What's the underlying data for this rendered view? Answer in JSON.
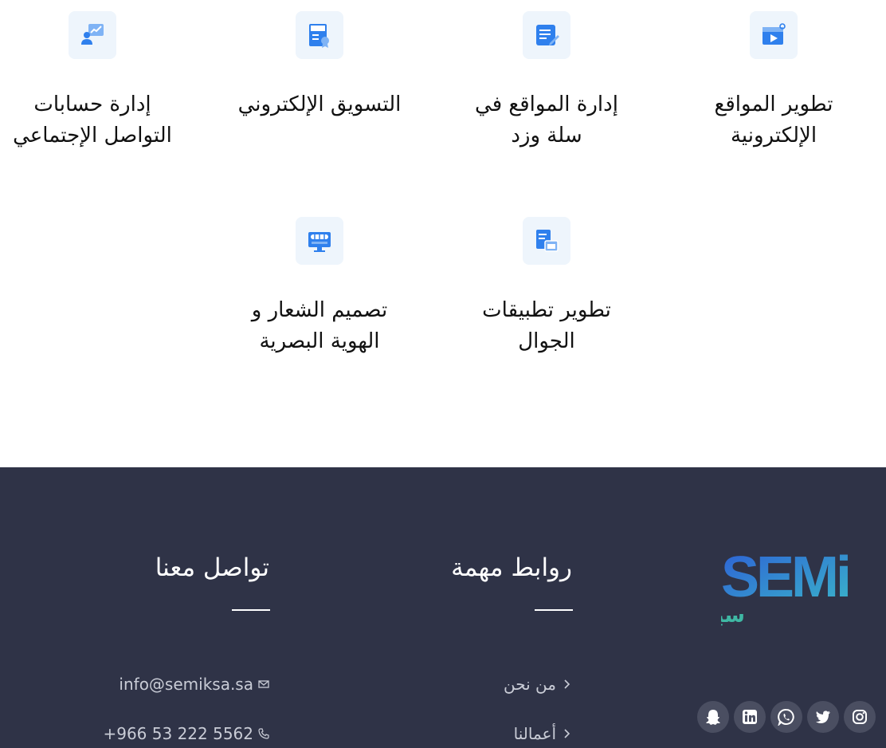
{
  "services": {
    "items": [
      {
        "title": "تطوير المواقع\nالإلكترونية",
        "icon": "video-web-icon"
      },
      {
        "title": "إدارة المواقع في\nسلة وزد",
        "icon": "edit-document-icon"
      },
      {
        "title": "التسويق الإلكتروني",
        "icon": "seo-certificate-icon"
      },
      {
        "title": "إدارة حسابات\nالتواصل الإجتماعي",
        "icon": "social-analytics-icon"
      },
      {
        "title": "تطوير تطبيقات\nالجوال",
        "icon": "mobile-apps-icon"
      },
      {
        "title": "تصميم الشعار و\nالهوية البصرية",
        "icon": "monitor-store-icon"
      }
    ],
    "accent": "#2f80ed",
    "tile_bg": "#eef5fc"
  },
  "footer": {
    "bg": "#2f3347",
    "logo": {
      "latin": "SEMi",
      "arabic": "سيمي"
    },
    "links_title": "روابط مهمة",
    "links": [
      "من نحن",
      "أعمالنا"
    ],
    "contact_title": "تواصل معنا",
    "email": "info@semiksa.sa",
    "phone": "+966 53 222 5562",
    "social": [
      "instagram-icon",
      "twitter-icon",
      "whatsapp-icon",
      "linkedin-icon",
      "snapchat-icon"
    ]
  }
}
